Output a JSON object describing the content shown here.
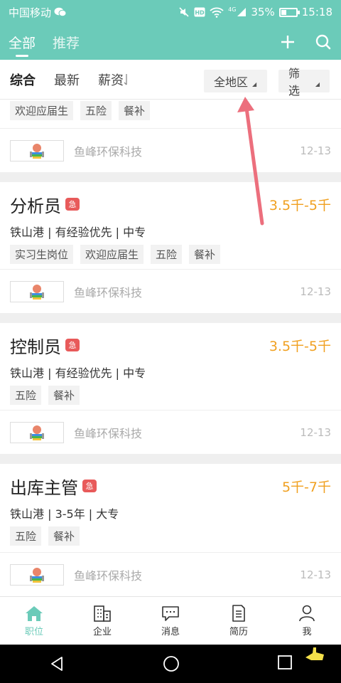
{
  "status_bar": {
    "carrier": "中国移动",
    "network": "4G",
    "battery": "35%",
    "battery_level": 0.35,
    "time": "15:18"
  },
  "app_bar": {
    "tabs": [
      {
        "label": "全部",
        "active": true
      },
      {
        "label": "推荐",
        "active": false
      }
    ]
  },
  "filter_bar": {
    "sort_options": [
      "综合",
      "最新",
      "薪资"
    ],
    "region": "全地区",
    "filter": "筛选"
  },
  "partial_card": {
    "tags": [
      "欢迎应届生",
      "五险",
      "餐补"
    ],
    "company": "鱼峰环保科技",
    "date": "12-13"
  },
  "jobs": [
    {
      "title": "分析员",
      "urgent": "急",
      "salary": "3.5千-5千",
      "meta": "铁山港 | 有经验优先 | 中专",
      "tags": [
        "实习生岗位",
        "欢迎应届生",
        "五险",
        "餐补"
      ],
      "company": "鱼峰环保科技",
      "date": "12-13"
    },
    {
      "title": "控制员",
      "urgent": "急",
      "salary": "3.5千-5千",
      "meta": "铁山港 | 有经验优先 | 中专",
      "tags": [
        "五险",
        "餐补"
      ],
      "company": "鱼峰环保科技",
      "date": "12-13"
    },
    {
      "title": "出库主管",
      "urgent": "急",
      "salary": "5千-7千",
      "meta": "铁山港 | 3-5年 | 大专",
      "tags": [
        "五险",
        "餐补"
      ],
      "company": "鱼峰环保科技",
      "date": "12-13"
    }
  ],
  "tab_bar": [
    {
      "label": "职位",
      "icon": "home-icon",
      "active": true
    },
    {
      "label": "企业",
      "icon": "building-icon",
      "active": false
    },
    {
      "label": "消息",
      "icon": "message-icon",
      "active": false
    },
    {
      "label": "简历",
      "icon": "document-icon",
      "active": false
    },
    {
      "label": "我",
      "icon": "person-icon",
      "active": false
    }
  ],
  "colors": {
    "brand": "#6bcbb9",
    "salary": "#f0a020",
    "urgent": "#e85a5a",
    "annotation_arrow": "#ec6f7d"
  }
}
